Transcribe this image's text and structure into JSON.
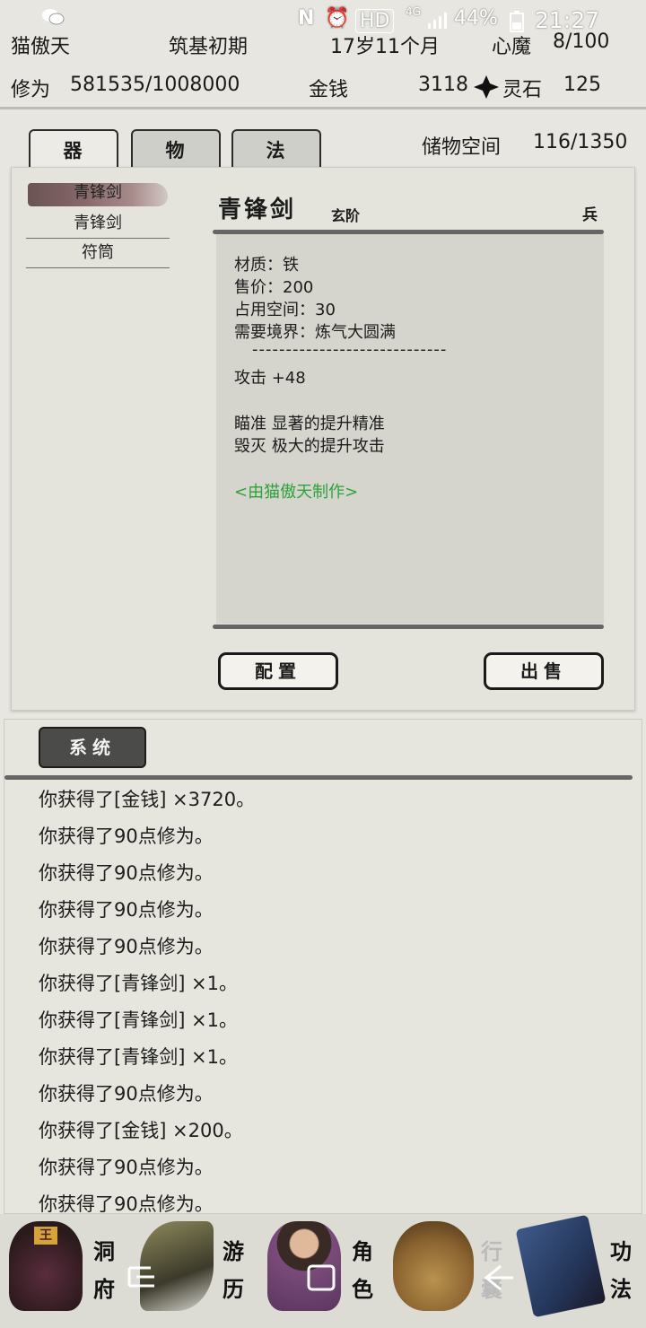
{
  "status_bar": {
    "wechat_icon": "wechat-icon",
    "network_badge": "HD",
    "network_type": "4G",
    "battery": "44%",
    "time": "21:27"
  },
  "header": {
    "name": "猫傲天",
    "realm": "筑基初期",
    "age": "17岁11个月",
    "inner_demon_label": "心魔",
    "inner_demon_value": "8/100",
    "cultivation_label": "修为",
    "cultivation_value": "581535/1008000",
    "money_label": "金钱",
    "money_value": "3118",
    "spirit_stone_label": "灵石",
    "spirit_stone_value": "125"
  },
  "tabs": [
    {
      "label": "器",
      "active": true
    },
    {
      "label": "物",
      "active": false
    },
    {
      "label": "法",
      "active": false
    }
  ],
  "storage": {
    "label": "储物空间",
    "value": "116/1350"
  },
  "items": [
    {
      "label": "青锋剑",
      "selected": true
    },
    {
      "label": "青锋剑",
      "selected": false
    },
    {
      "label": "符筒",
      "selected": false
    }
  ],
  "detail": {
    "title": "青锋剑",
    "grade": "玄阶",
    "type": "兵",
    "material": "材质：铁",
    "price": "售价：200",
    "space": "占用空间：30",
    "realm_req": "需要境界：炼气大圆满",
    "divider": "-----------------------------",
    "attack": "攻击 +48",
    "trait1": "瞄准 显著的提升精准",
    "trait2": "毁灭 极大的提升攻击",
    "maker": "<由猫傲天制作>"
  },
  "buttons": {
    "equip": "配置",
    "sell": "出售"
  },
  "system": {
    "tab_label": "系统",
    "logs": [
      "你获得了[金钱] ×3720。",
      "你获得了90点修为。",
      "你获得了90点修为。",
      "你获得了90点修为。",
      "你获得了90点修为。",
      "你获得了[青锋剑] ×1。",
      "你获得了[青锋剑] ×1。",
      "你获得了[青锋剑] ×1。",
      "你获得了90点修为。",
      "你获得了[金钱] ×200。",
      "你获得了90点修为。",
      "你获得了90点修为。"
    ]
  },
  "nav": {
    "dongfu": [
      "洞",
      "府"
    ],
    "youli": [
      "游",
      "历"
    ],
    "juese": [
      "角",
      "色"
    ],
    "xingnang": [
      "行",
      "囊"
    ],
    "gongfa": [
      "功",
      "法"
    ],
    "king_badge": "王"
  },
  "colors": {
    "green_text": "#2ea33a",
    "paper": "#e4e3dc",
    "ink": "#1c1c1c"
  }
}
